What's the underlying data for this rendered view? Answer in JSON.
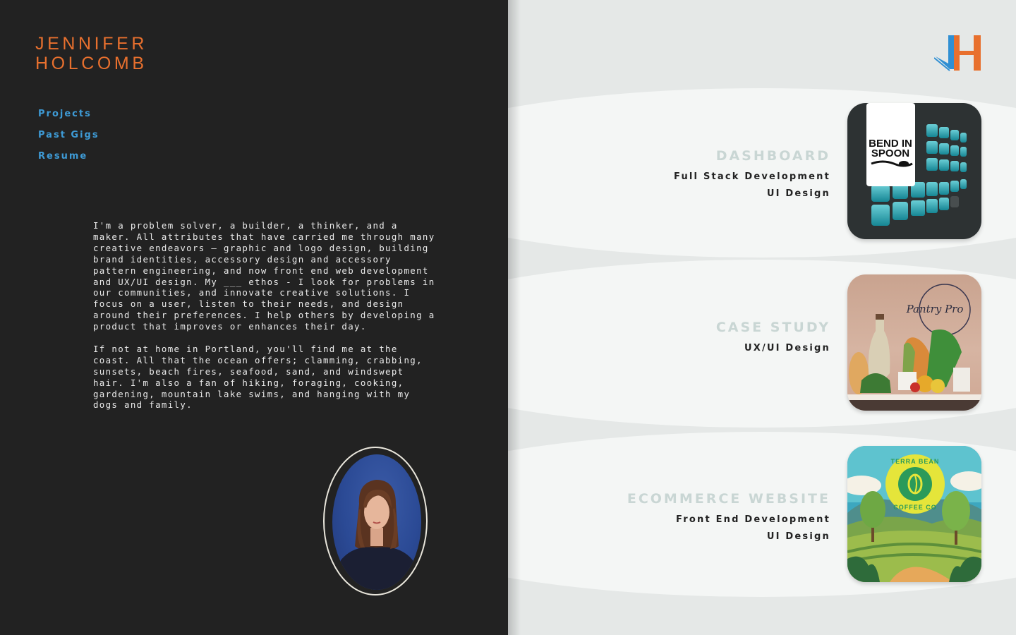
{
  "profile": {
    "name_line1": "JENNIFER",
    "name_line2": "HOLCOMB"
  },
  "nav": {
    "items": [
      {
        "label": "Projects"
      },
      {
        "label": "Past Gigs"
      },
      {
        "label": "Resume"
      }
    ]
  },
  "bio": {
    "paragraph1": "I'm a problem solver, a builder, a thinker, and a maker. All attributes that have carried me through many creative endeavors — graphic and logo design, building brand identities, accessory design and accessory pattern engineering, and now front end web development and UX/UI design. My ___ ethos - I look for problems in our communities, and innovate creative solutions. I focus on a user, listen to their needs, and design around their preferences. I help others by developing a product that improves or enhances their day.",
    "paragraph2": "If not at home in Portland, you'll find me at the coast. All that the ocean offers; clamming, crabbing, sunsets, beach fires, seafood, sand, and windswept hair. I'm also a fan of hiking, foraging, cooking, gardening, mountain lake swims, and hanging with my dogs and family."
  },
  "projects": [
    {
      "title": "DASHBOARD",
      "roles": [
        "Full Stack Development",
        "UI Design"
      ],
      "thumb_text": [
        "BEND IN",
        "SPOON"
      ]
    },
    {
      "title": "CASE STUDY",
      "roles": [
        "UX/UI Design"
      ],
      "thumb_text": [
        "Pantry Pro"
      ]
    },
    {
      "title": "ECOMMERCE WEBSITE",
      "roles": [
        "Front End Development",
        "UI Design"
      ],
      "thumb_text": [
        "TERRA BEAN",
        "COFFEE CO"
      ]
    }
  ],
  "colors": {
    "accent_orange": "#e8702e",
    "link_blue": "#3e9bd6",
    "dark_bg": "#222222",
    "light_bg": "#e5e8e7",
    "project_title": "#c9d6d4"
  },
  "icons": {
    "brand_logo": "jh-monogram-icon"
  }
}
